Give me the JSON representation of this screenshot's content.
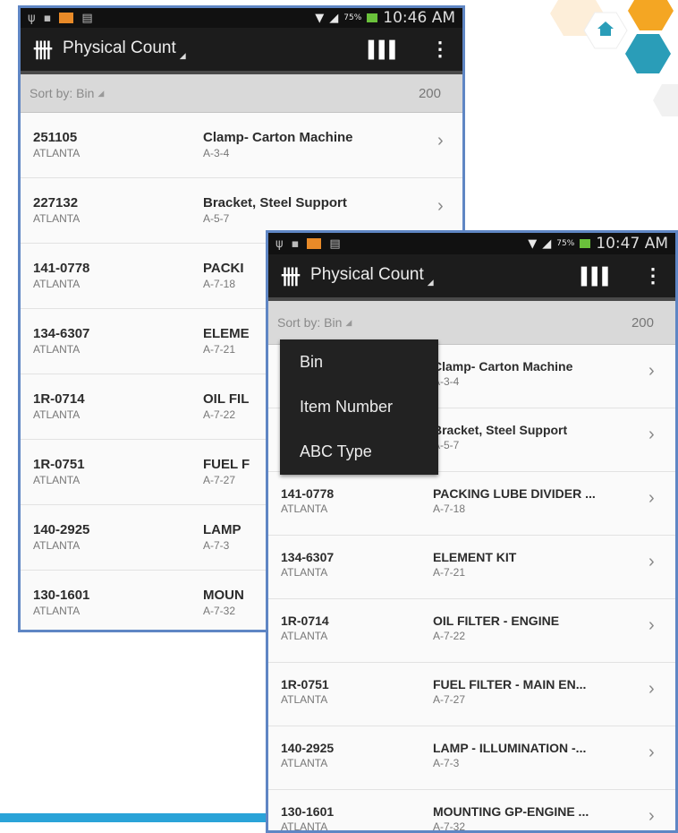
{
  "colors": {
    "accent": "#2aa3d8",
    "frame": "#5f86c4",
    "actionbar": "#1c1c1c",
    "hex_orange": "#f4a623",
    "hex_teal": "#2a9db8"
  },
  "icons": {
    "app": "tally-marks-icon",
    "barcode": "barcode-scan-icon",
    "overflow": "vertical-ellipsis-icon",
    "home": "home-icon",
    "chevron": "chevron-right-icon"
  },
  "phone1": {
    "status": {
      "time": "10:46 AM",
      "battery": "75%"
    },
    "title": "Physical Count",
    "sort_label": "Sort by: Bin",
    "count": "200",
    "items": [
      {
        "number": "251105",
        "location": "ATLANTA",
        "description": "Clamp- Carton Machine",
        "bin": "A-3-4"
      },
      {
        "number": "227132",
        "location": "ATLANTA",
        "description": "Bracket, Steel Support",
        "bin": "A-5-7"
      },
      {
        "number": "141-0778",
        "location": "ATLANTA",
        "description": "PACKI",
        "bin": "A-7-18"
      },
      {
        "number": "134-6307",
        "location": "ATLANTA",
        "description": "ELEME",
        "bin": "A-7-21"
      },
      {
        "number": "1R-0714",
        "location": "ATLANTA",
        "description": "OIL FIL",
        "bin": "A-7-22"
      },
      {
        "number": "1R-0751",
        "location": "ATLANTA",
        "description": "FUEL F",
        "bin": "A-7-27"
      },
      {
        "number": "140-2925",
        "location": "ATLANTA",
        "description": "LAMP",
        "bin": "A-7-3"
      },
      {
        "number": "130-1601",
        "location": "ATLANTA",
        "description": "MOUN",
        "bin": "A-7-32"
      }
    ]
  },
  "phone2": {
    "status": {
      "time": "10:47 AM",
      "battery": "75%"
    },
    "title": "Physical Count",
    "sort_label": "Sort by: Bin",
    "count": "200",
    "menu": [
      "Bin",
      "Item Number",
      "ABC Type"
    ],
    "items": [
      {
        "number": "",
        "location": "",
        "description": "Clamp- Carton Machine",
        "bin": "A-3-4"
      },
      {
        "number": "",
        "location": "",
        "description": "Bracket, Steel Support",
        "bin": "A-5-7"
      },
      {
        "number": "141-0778",
        "location": "ATLANTA",
        "description": "PACKING LUBE DIVIDER ...",
        "bin": "A-7-18"
      },
      {
        "number": "134-6307",
        "location": "ATLANTA",
        "description": "ELEMENT KIT",
        "bin": "A-7-21"
      },
      {
        "number": "1R-0714",
        "location": "ATLANTA",
        "description": "OIL FILTER - ENGINE",
        "bin": "A-7-22"
      },
      {
        "number": "1R-0751",
        "location": "ATLANTA",
        "description": "FUEL FILTER - MAIN EN...",
        "bin": "A-7-27"
      },
      {
        "number": "140-2925",
        "location": "ATLANTA",
        "description": "LAMP - ILLUMINATION -...",
        "bin": "A-7-3"
      },
      {
        "number": "130-1601",
        "location": "ATLANTA",
        "description": "MOUNTING GP-ENGINE ...",
        "bin": "A-7-32"
      }
    ]
  }
}
